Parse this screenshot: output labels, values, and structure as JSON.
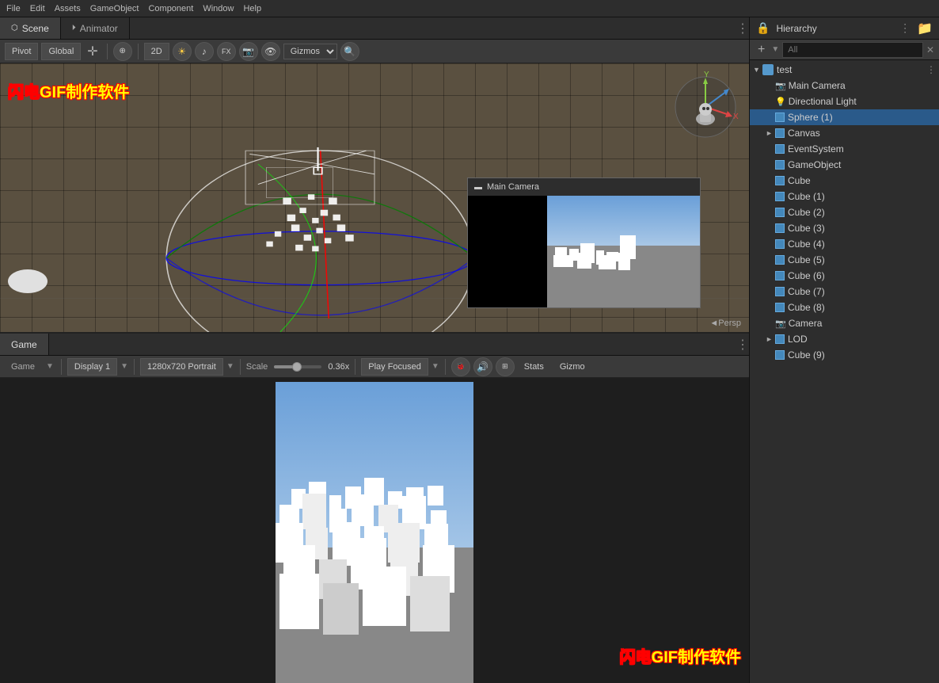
{
  "tabs": {
    "scene": "Scene",
    "animator": "Animator",
    "game": "Game"
  },
  "toolbar": {
    "pivot": "Pivot",
    "global": "Global",
    "2d": "2D",
    "stats": "Stats",
    "gizmos": "Gizmo",
    "play_focused": "Play Focused",
    "display": "Display 1",
    "resolution": "1280x720 Portrait",
    "scale_label": "Scale",
    "scale_value": "0.36x"
  },
  "scene": {
    "persp_label": "◄Persp",
    "camera_preview_title": "Main Camera",
    "watermark": "闪电GIF制作软件"
  },
  "hierarchy": {
    "title": "Hierarchy",
    "search_placeholder": "All",
    "add_label": "+",
    "items": [
      {
        "name": "test",
        "indent": 0,
        "type": "root",
        "arrow": "▼",
        "icon": "unity"
      },
      {
        "name": "Main Camera",
        "indent": 1,
        "type": "camera",
        "arrow": "",
        "icon": "cube"
      },
      {
        "name": "Directional Light",
        "indent": 1,
        "type": "light",
        "arrow": "",
        "icon": "cube"
      },
      {
        "name": "Sphere (1)",
        "indent": 1,
        "type": "object",
        "arrow": "",
        "icon": "cube"
      },
      {
        "name": "Canvas",
        "indent": 1,
        "type": "object",
        "arrow": "►",
        "icon": "cube"
      },
      {
        "name": "EventSystem",
        "indent": 1,
        "type": "object",
        "arrow": "",
        "icon": "cube"
      },
      {
        "name": "GameObject",
        "indent": 1,
        "type": "object",
        "arrow": "",
        "icon": "cube"
      },
      {
        "name": "Cube",
        "indent": 1,
        "type": "object",
        "arrow": "",
        "icon": "cube"
      },
      {
        "name": "Cube (1)",
        "indent": 1,
        "type": "object",
        "arrow": "",
        "icon": "cube"
      },
      {
        "name": "Cube (2)",
        "indent": 1,
        "type": "object",
        "arrow": "",
        "icon": "cube"
      },
      {
        "name": "Cube (3)",
        "indent": 1,
        "type": "object",
        "arrow": "",
        "icon": "cube"
      },
      {
        "name": "Cube (4)",
        "indent": 1,
        "type": "object",
        "arrow": "",
        "icon": "cube"
      },
      {
        "name": "Cube (5)",
        "indent": 1,
        "type": "object",
        "arrow": "",
        "icon": "cube"
      },
      {
        "name": "Cube (6)",
        "indent": 1,
        "type": "object",
        "arrow": "",
        "icon": "cube"
      },
      {
        "name": "Cube (7)",
        "indent": 1,
        "type": "object",
        "arrow": "",
        "icon": "cube"
      },
      {
        "name": "Cube (8)",
        "indent": 1,
        "type": "object",
        "arrow": "",
        "icon": "cube"
      },
      {
        "name": "Camera",
        "indent": 1,
        "type": "camera",
        "arrow": "",
        "icon": "cube"
      },
      {
        "name": "LOD",
        "indent": 1,
        "type": "object",
        "arrow": "►",
        "icon": "cube"
      },
      {
        "name": "Cube (9)",
        "indent": 1,
        "type": "object",
        "arrow": "",
        "icon": "cube"
      }
    ]
  }
}
